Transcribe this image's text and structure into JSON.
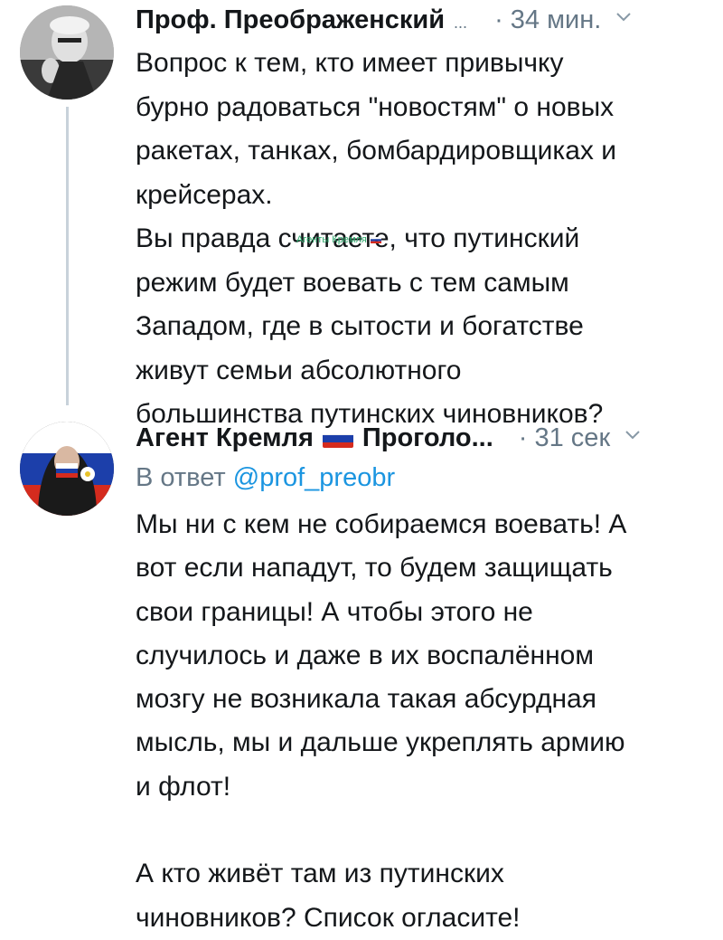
{
  "tweet1": {
    "author": "Проф. Преображенский",
    "ellipsis": "...",
    "time": "· 34 мин.",
    "text": "Вопрос к тем, кто имеет привычку\nбурно радоваться \"новостям\" о новых\nракетах, танках, бомбардировщиках и\nкрейсерах.\nВы правда считаете, что путинский\nрежим будет воевать с тем самым\nЗападом, где в сытости и богатстве\nживут семьи абсолютного\nбольшинства путинских чиновников?"
  },
  "watermark": "Агенты Кремля",
  "tweet2": {
    "author_a": "Агент Кремля",
    "author_b": "Проголо...",
    "time": "· 31 сек",
    "reply_prefix": "В ответ ",
    "reply_handle": "@prof_preobr",
    "text": "Мы ни с кем не собираемся воевать! А\nвот если нападут, то будем защищать\nсвои границы! А чтобы этого не\nслучилось и даже в их воспалённом\nмозгу не возникала такая абсурдная\nмысль, мы и дальше укреплять армию\nи флот!\n\nА кто живёт там из путинских\nчиновников? Список огласите!"
  },
  "icons": [
    "avatar-prof",
    "avatar-agent",
    "chevron-down-icon",
    "russian-flag-icon"
  ],
  "colors": {
    "link": "#1b95e0",
    "muted": "#657786",
    "text": "#14171a",
    "thread_line": "#c8d2da"
  }
}
